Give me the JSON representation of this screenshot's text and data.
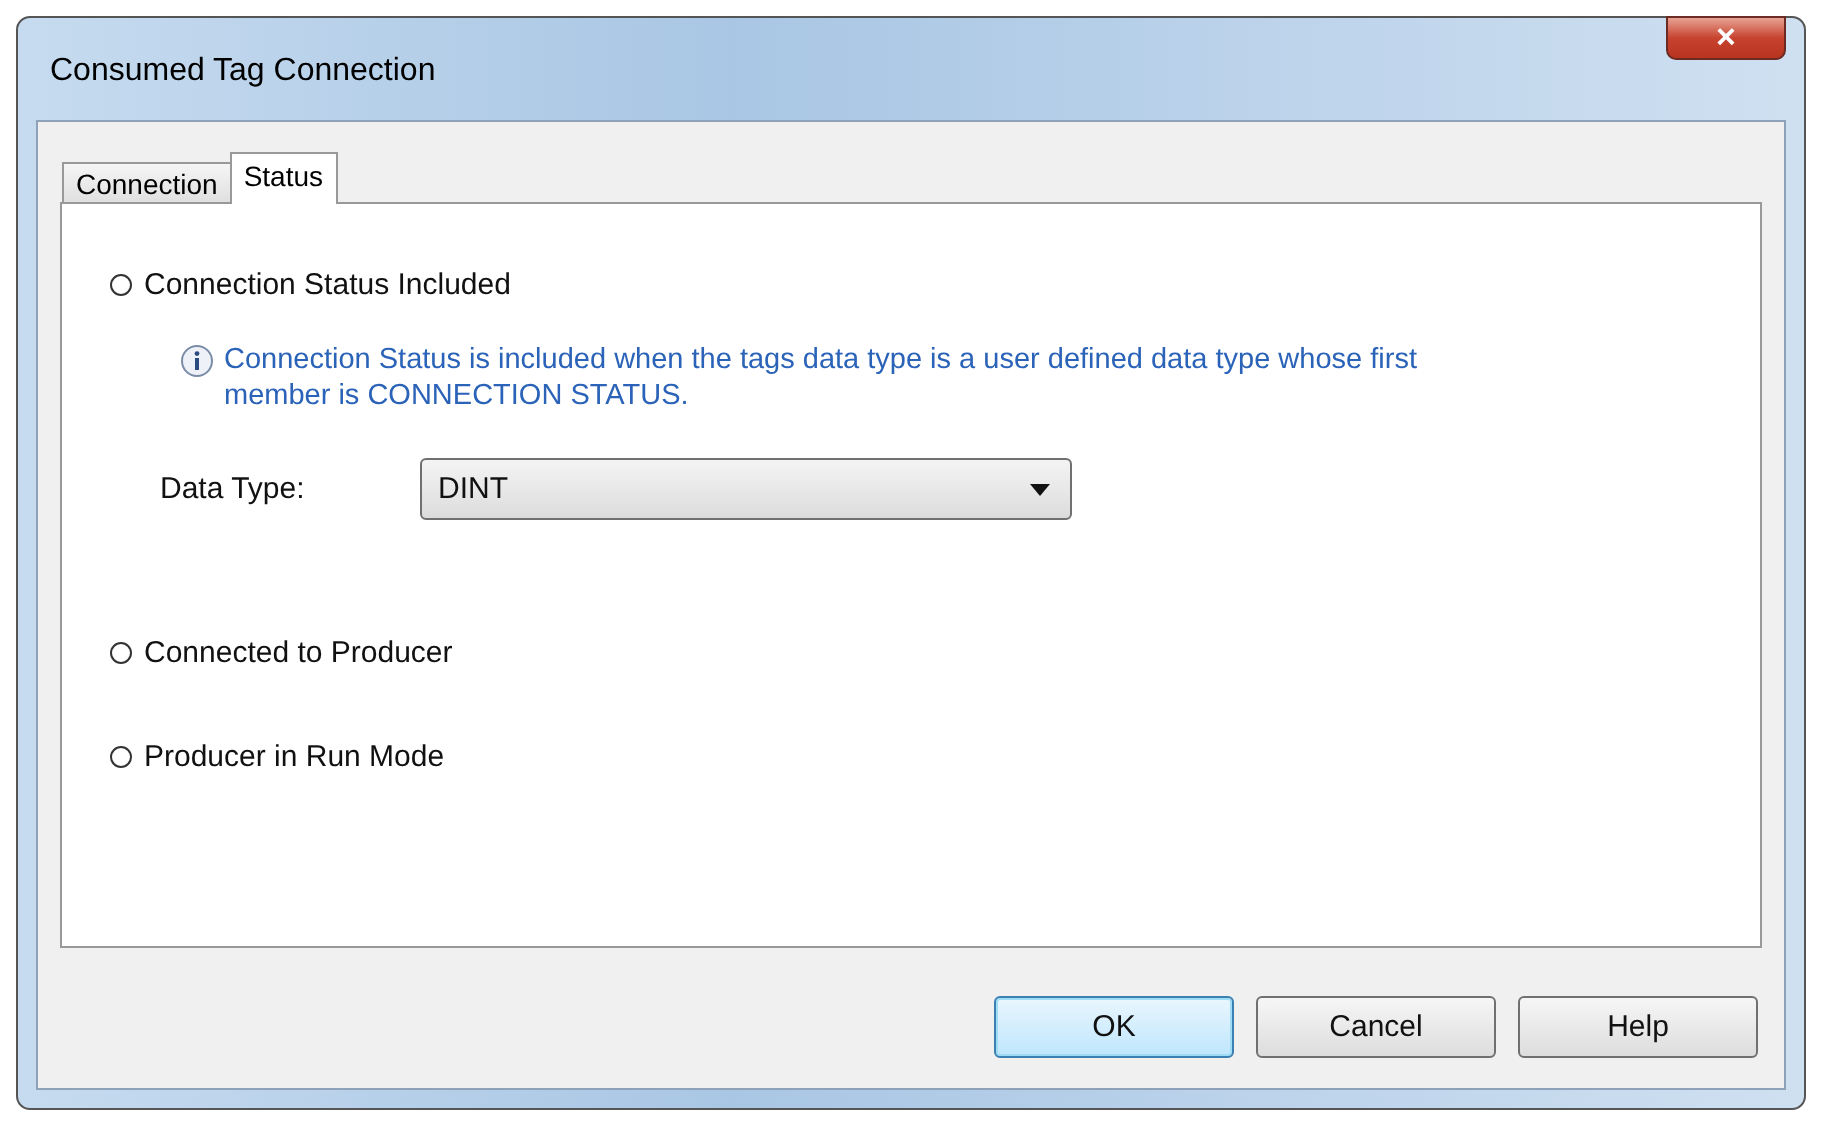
{
  "window": {
    "title": "Consumed Tag Connection",
    "close_icon": "×"
  },
  "tabs": [
    {
      "label": "Connection",
      "selected": false
    },
    {
      "label": "Status",
      "selected": true
    }
  ],
  "options": [
    {
      "kind": "radio",
      "label": "Connection Status Included",
      "selected": false
    },
    {
      "kind": "info",
      "text": "Connection Status is included when the tags data type is a user defined data type whose first member is CONNECTION STATUS."
    },
    {
      "kind": "dropdown",
      "label": "Data Type:",
      "value": "DINT"
    },
    {
      "kind": "radio",
      "label": "Connected to Producer",
      "selected": false
    },
    {
      "kind": "radio",
      "label": "Producer in Run Mode",
      "selected": false
    }
  ],
  "buttons": [
    {
      "label": "OK",
      "default": true
    },
    {
      "label": "Cancel",
      "default": false
    },
    {
      "label": "Help",
      "default": false
    }
  ]
}
